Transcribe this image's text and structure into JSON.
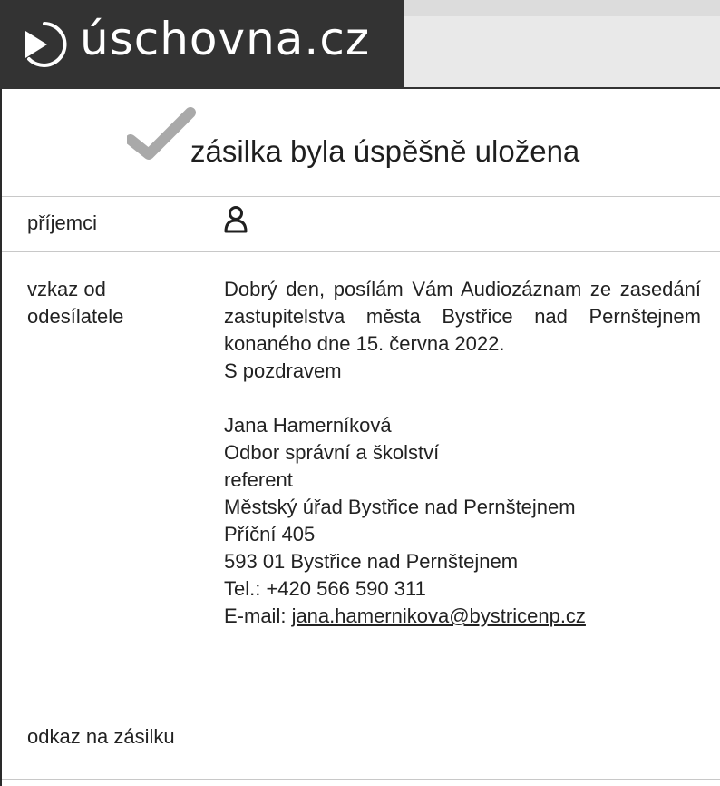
{
  "header": {
    "logo_text": "úschovna.cz",
    "logo_icon": "play-circle-icon"
  },
  "status": {
    "icon": "checkmark-icon",
    "message": "zásilka byla úspěšně uložena"
  },
  "rows": {
    "recipients": {
      "label": "příjemci",
      "icon": "user-icon"
    },
    "sender_message": {
      "label_line1": "vzkaz od",
      "label_line2": "odesílatele",
      "intro": "Dobrý den, posílám Vám Audiozáznam ze zasedání zastupitelstva města Bystřice nad Pernštejnem konaného dne 15. června 2022.",
      "greeting": "S pozdravem",
      "signature": {
        "name": "Jana Hamerníková",
        "department": "Odbor správní a školství",
        "position": "referent",
        "office": "Městský úřad Bystřice nad Pernštejnem",
        "street": "Příční 405",
        "city": "593 01 Bystřice nad Pernštejnem",
        "phone": "Tel.: +420 566 590 311",
        "email_prefix": "E-mail: ",
        "email": "jana.hamernikova@bystricenp.cz"
      }
    },
    "link": {
      "label": "odkaz na zásilku"
    }
  },
  "colors": {
    "logo_bar": "#333333",
    "checkmark": "#a9a9a9"
  }
}
